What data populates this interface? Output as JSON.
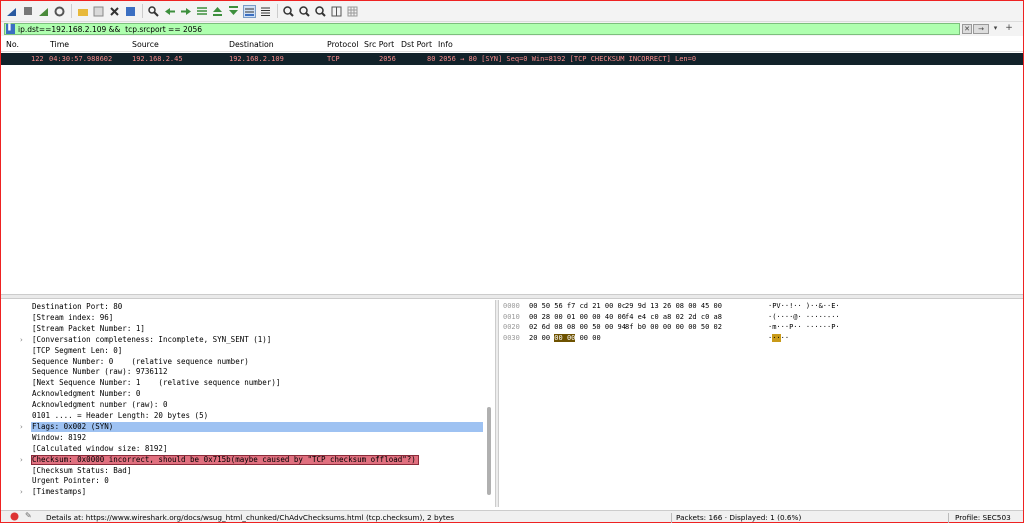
{
  "toolbar": {
    "icons": [
      "shark-fin-start-icon",
      "stop-square-icon",
      "restart-icon",
      "gear-options-icon",
      "open-folder-icon",
      "save-file-icon",
      "close-file-icon",
      "reload-icon",
      "find-icon",
      "go-back-icon",
      "go-forward-icon",
      "go-to-packet-icon",
      "first-packet-icon",
      "last-packet-icon",
      "autoscroll-icon",
      "colorize-icon",
      "zoom-in-icon",
      "zoom-out-icon",
      "zoom-normal-icon",
      "resize-columns-icon",
      "grid-icon"
    ]
  },
  "filter": {
    "value": "ip.dst==192.168.2.109 &&  tcp.srcport == 2056",
    "bg_color": "#afffaf"
  },
  "packet_list": {
    "columns": [
      "No.",
      "Time",
      "Source",
      "Destination",
      "Protocol",
      "Src Port",
      "Dst Port",
      "Info"
    ],
    "rows": [
      {
        "no": "122",
        "time": "04:30:57.988602",
        "source": "192.168.2.45",
        "destination": "192.168.2.109",
        "protocol": "TCP",
        "src_port": "2056",
        "dst_port": "80",
        "info": "2056 → 80 [SYN] Seq=0 Win=8192 [TCP CHECKSUM INCORRECT] Len=0"
      }
    ],
    "row_bg": "#12222a",
    "row_fg": "#f78b8b"
  },
  "details": {
    "lines": [
      {
        "text": "Destination Port: 80",
        "expandable": false
      },
      {
        "text": "[Stream index: 96]",
        "expandable": false
      },
      {
        "text": "[Stream Packet Number: 1]",
        "expandable": false
      },
      {
        "text": "[Conversation completeness: Incomplete, SYN_SENT (1)]",
        "expandable": true
      },
      {
        "text": "[TCP Segment Len: 0]",
        "expandable": false
      },
      {
        "text": "Sequence Number: 0    (relative sequence number)",
        "expandable": false
      },
      {
        "text": "Sequence Number (raw): 9736112",
        "expandable": false
      },
      {
        "text": "[Next Sequence Number: 1    (relative sequence number)]",
        "expandable": false
      },
      {
        "text": "Acknowledgment Number: 0",
        "expandable": false
      },
      {
        "text": "Acknowledgment number (raw): 0",
        "expandable": false
      },
      {
        "text": "0101 .... = Header Length: 20 bytes (5)",
        "expandable": false
      },
      {
        "text": "Flags: 0x002 (SYN)",
        "expandable": true,
        "highlight": "blue"
      },
      {
        "text": "Window: 8192",
        "expandable": false
      },
      {
        "text": "[Calculated window size: 8192]",
        "expandable": false
      },
      {
        "text": "Checksum: 0x0000 incorrect, should be 0x715b(maybe caused by \"TCP checksum offload\"?)",
        "expandable": true,
        "highlight": "red"
      },
      {
        "text": "[Checksum Status: Bad]",
        "expandable": false
      },
      {
        "text": "Urgent Pointer: 0",
        "expandable": false
      },
      {
        "text": "[Timestamps]",
        "expandable": true
      }
    ]
  },
  "hex": {
    "rows": [
      {
        "offset": "0000",
        "bytes_a": "00 50 56 f7 cd 21 00 0c",
        "bytes_b": "29 9d 13 26 08 00 45 00",
        "ascii": "·PV··!·· )··&··E·"
      },
      {
        "offset": "0010",
        "bytes_a": "00 28 00 01 00 00 40 06",
        "bytes_b": "f4 e4 c0 a8 02 2d c0 a8",
        "ascii": "·(····@· ·····-··"
      },
      {
        "offset": "0020",
        "bytes_a": "02 6d 08 08 00 50 00 94",
        "bytes_b": "8f b0 00 00 00 00 50 02",
        "ascii": "·m···P·· ······P·"
      },
      {
        "offset": "0030",
        "bytes_pre": "20 00 ",
        "bytes_hl": "00 00",
        "bytes_post": " 00 00",
        "ascii_pre": "·",
        "ascii_hl": "··",
        "ascii_post": "··"
      }
    ]
  },
  "status": {
    "details": "Details at: https://www.wireshark.org/docs/wsug_html_chunked/ChAdvChecksums.html (tcp.checksum), 2 bytes",
    "packets": "Packets: 166 · Displayed: 1 (0.6%)",
    "profile": "Profile: SEC503"
  }
}
